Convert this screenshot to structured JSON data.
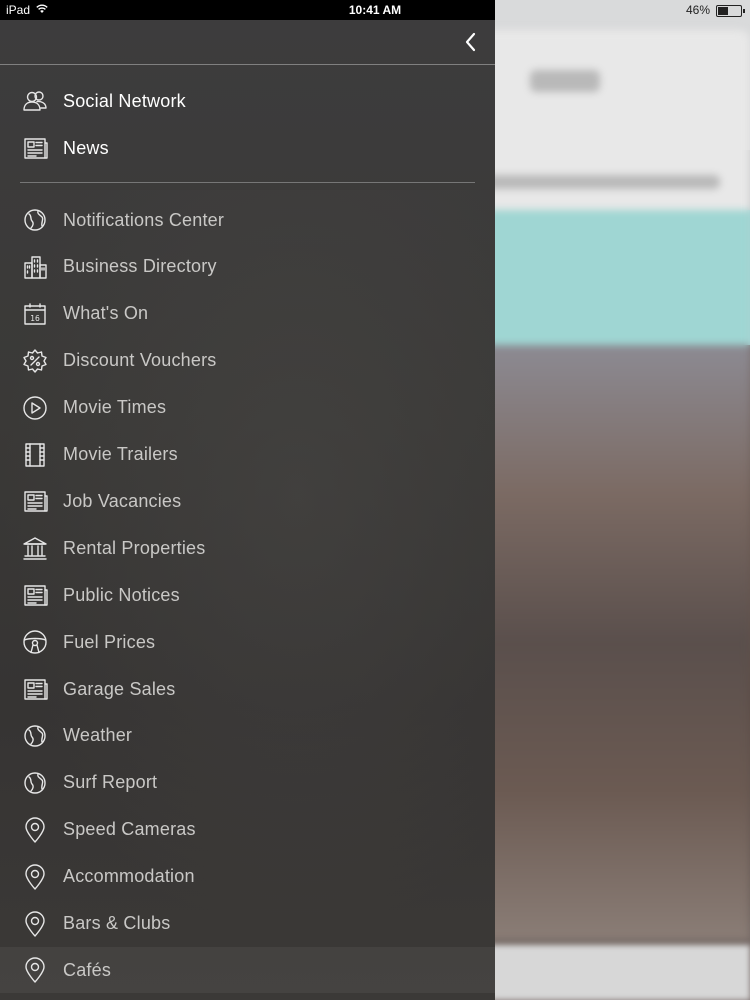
{
  "status_bar": {
    "device": "iPad",
    "time": "10:41 AM",
    "battery_percent": "46%",
    "battery_level": 0.46
  },
  "drawer": {
    "primary_items": [
      {
        "label": "Social Network",
        "icon": "people-icon"
      },
      {
        "label": "News",
        "icon": "newspaper-icon"
      }
    ],
    "items": [
      {
        "label": "Notifications Center",
        "icon": "globe-icon"
      },
      {
        "label": "Business Directory",
        "icon": "buildings-icon"
      },
      {
        "label": "What's On",
        "icon": "calendar-icon",
        "calendar_day": "16"
      },
      {
        "label": "Discount Vouchers",
        "icon": "percent-badge-icon"
      },
      {
        "label": "Movie Times",
        "icon": "play-circle-icon"
      },
      {
        "label": "Movie Trailers",
        "icon": "film-strip-icon"
      },
      {
        "label": "Job Vacancies",
        "icon": "newspaper-icon"
      },
      {
        "label": "Rental Properties",
        "icon": "bank-icon"
      },
      {
        "label": "Public Notices",
        "icon": "newspaper-icon"
      },
      {
        "label": "Fuel Prices",
        "icon": "steering-wheel-icon"
      },
      {
        "label": "Garage Sales",
        "icon": "newspaper-icon"
      },
      {
        "label": "Weather",
        "icon": "globe-icon"
      },
      {
        "label": "Surf Report",
        "icon": "globe-icon"
      },
      {
        "label": "Speed Cameras",
        "icon": "map-pin-icon"
      },
      {
        "label": "Accommodation",
        "icon": "map-pin-icon"
      },
      {
        "label": "Bars & Clubs",
        "icon": "map-pin-icon"
      },
      {
        "label": "Cafés",
        "icon": "map-pin-icon"
      }
    ]
  },
  "colors": {
    "drawer_bg": "#3a3937",
    "primary_text": "#ffffff",
    "item_text": "#c9c8c6"
  }
}
